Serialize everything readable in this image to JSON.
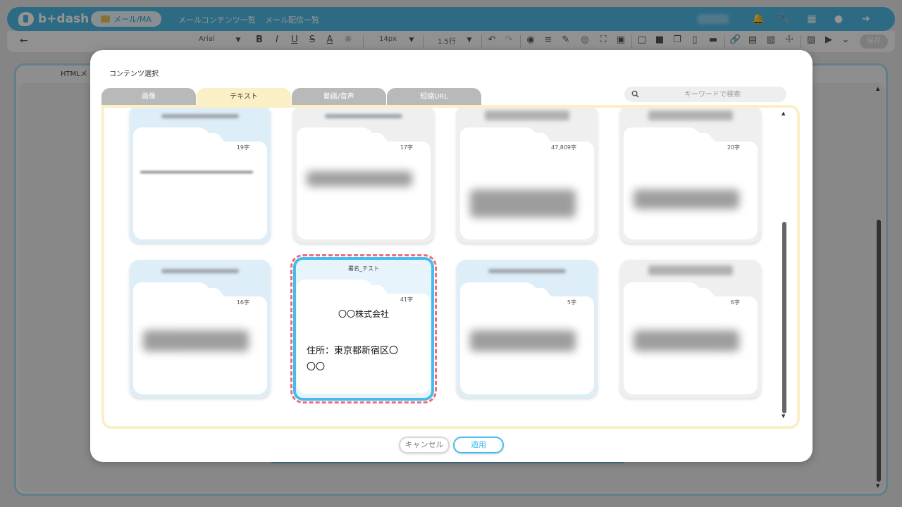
{
  "app": {
    "logo": "b+dash",
    "nav_pill_label": "メール/MA",
    "nav_links": [
      "メールコンテンツ一覧",
      "メール配信一覧"
    ],
    "nav_icons": [
      "bell-icon",
      "wrench-icon",
      "grid-icon",
      "chat-icon",
      "logout-icon"
    ],
    "toolbar": {
      "font": "Arial",
      "size": "14px",
      "line_height": "1.5行",
      "save_label": "保存"
    },
    "editor_tab_label": "HTMLメ"
  },
  "modal": {
    "title": "コンテンツ選択",
    "tabs": [
      {
        "label": "画像",
        "active": false
      },
      {
        "label": "テキスト",
        "active": true
      },
      {
        "label": "動画/音声",
        "active": false
      },
      {
        "label": "短縮URL",
        "active": false
      }
    ],
    "search": {
      "placeholder": "キーワードで検索"
    },
    "cards": [
      {
        "count": "19字",
        "color": "blue"
      },
      {
        "count": "17字",
        "color": "gray"
      },
      {
        "count": "47,809字",
        "color": "gray"
      },
      {
        "count": "20字",
        "color": "gray"
      },
      {
        "count": "16字",
        "color": "blue"
      },
      {
        "count": "41字",
        "color": "blue",
        "selected": true,
        "title": "署名_テスト",
        "lines": [
          "〇〇株式会社",
          "住所：東京都新宿区〇",
          "〇〇"
        ]
      },
      {
        "count": "5字",
        "color": "blue"
      },
      {
        "count": "6字",
        "color": "gray"
      }
    ],
    "buttons": {
      "cancel": "キャンセル",
      "apply": "適用"
    }
  }
}
